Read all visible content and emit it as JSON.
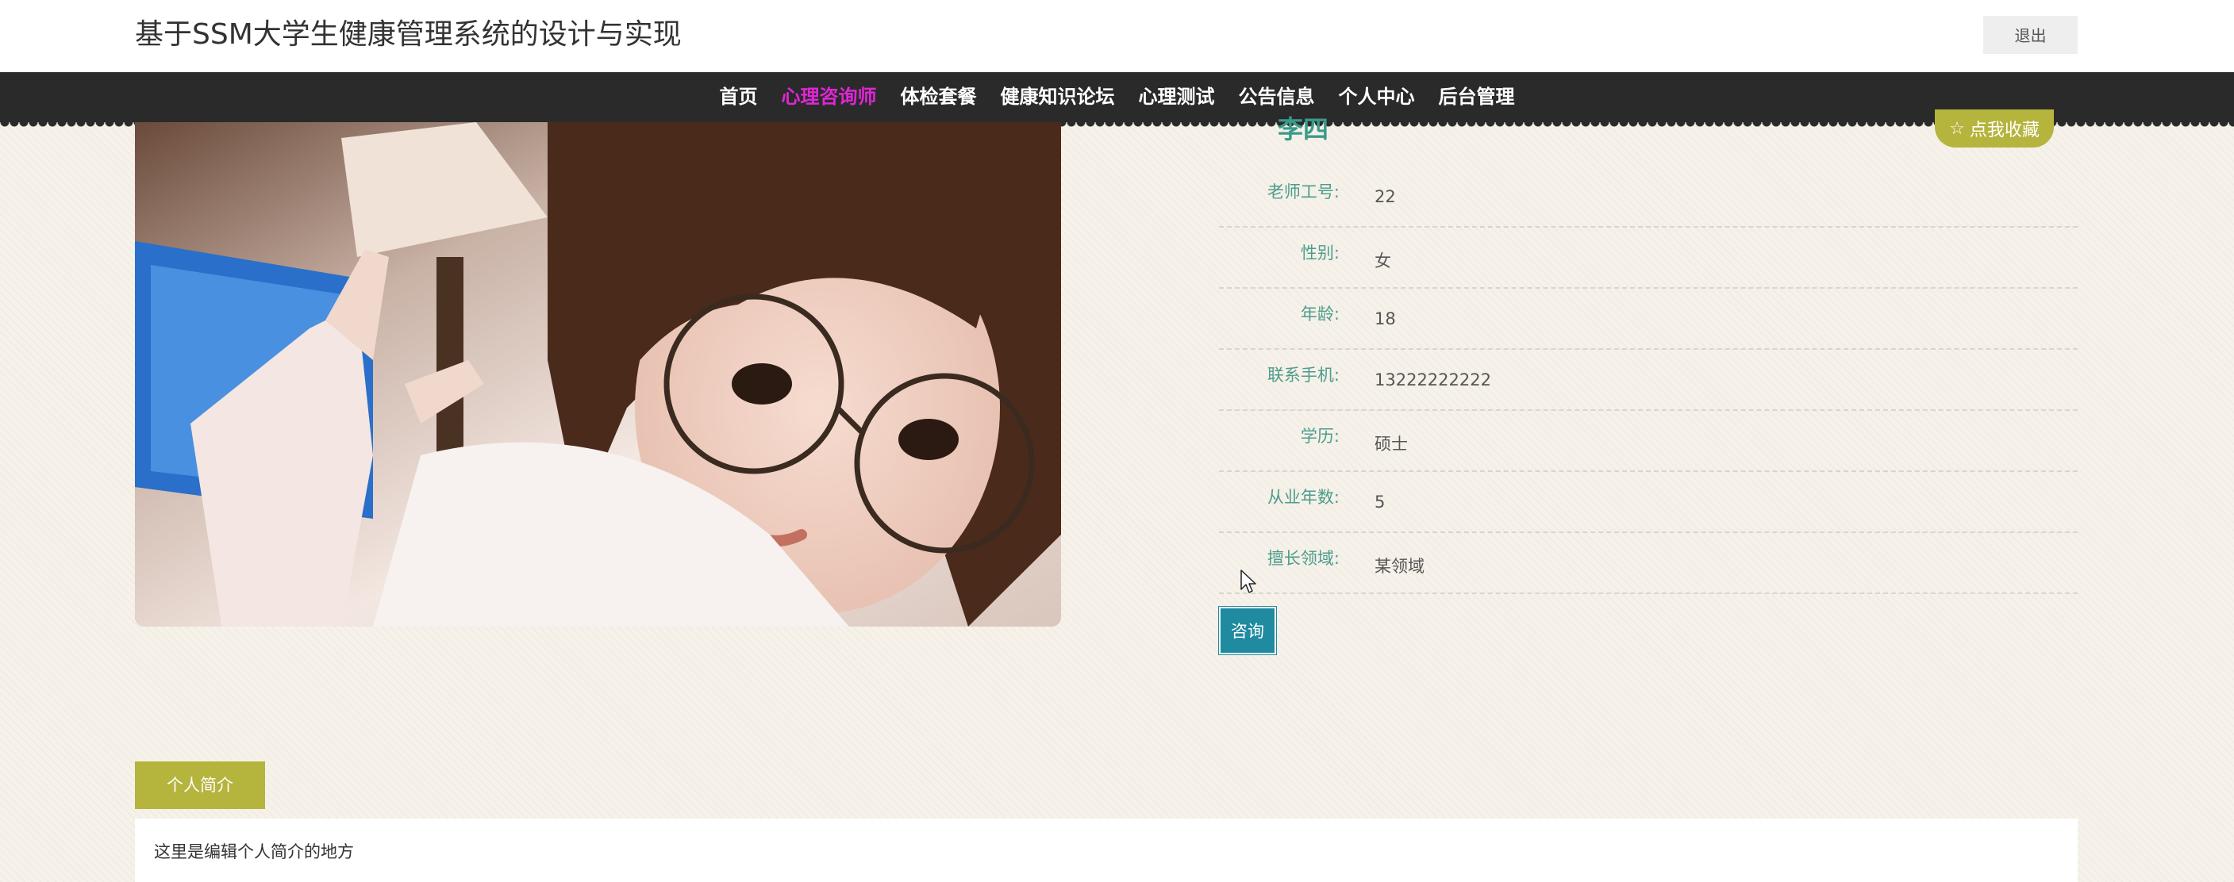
{
  "header": {
    "title": "基于SSM大学生健康管理系统的设计与实现",
    "logout_label": "退出"
  },
  "nav": {
    "items": [
      {
        "label": "首页",
        "active": false
      },
      {
        "label": "心理咨询师",
        "active": true
      },
      {
        "label": "体检套餐",
        "active": false
      },
      {
        "label": "健康知识论坛",
        "active": false
      },
      {
        "label": "心理测试",
        "active": false
      },
      {
        "label": "公告信息",
        "active": false
      },
      {
        "label": "个人中心",
        "active": false
      },
      {
        "label": "后台管理",
        "active": false
      }
    ]
  },
  "detail": {
    "name": "李四",
    "favorite_label": "点我收藏",
    "fields": [
      {
        "label": "老师工号:",
        "value": "22"
      },
      {
        "label": "性别:",
        "value": "女"
      },
      {
        "label": "年龄:",
        "value": "18"
      },
      {
        "label": "联系手机:",
        "value": "13222222222"
      },
      {
        "label": "学历:",
        "value": "硕士"
      },
      {
        "label": "从业年数:",
        "value": "5"
      },
      {
        "label": "擅长领域:",
        "value": "某领域"
      }
    ],
    "consult_label": "咨询"
  },
  "tabs": {
    "intro_label": "个人简介"
  },
  "intro": {
    "text": "这里是编辑个人简介的地方"
  },
  "colors": {
    "accent_olive": "#b5b43c",
    "accent_teal": "#1f8aa0",
    "nav_active": "#e026d6",
    "label_green": "#4c9c8c"
  },
  "icons": {
    "favorite": "star-icon",
    "cursor": "mouse-pointer-icon"
  }
}
